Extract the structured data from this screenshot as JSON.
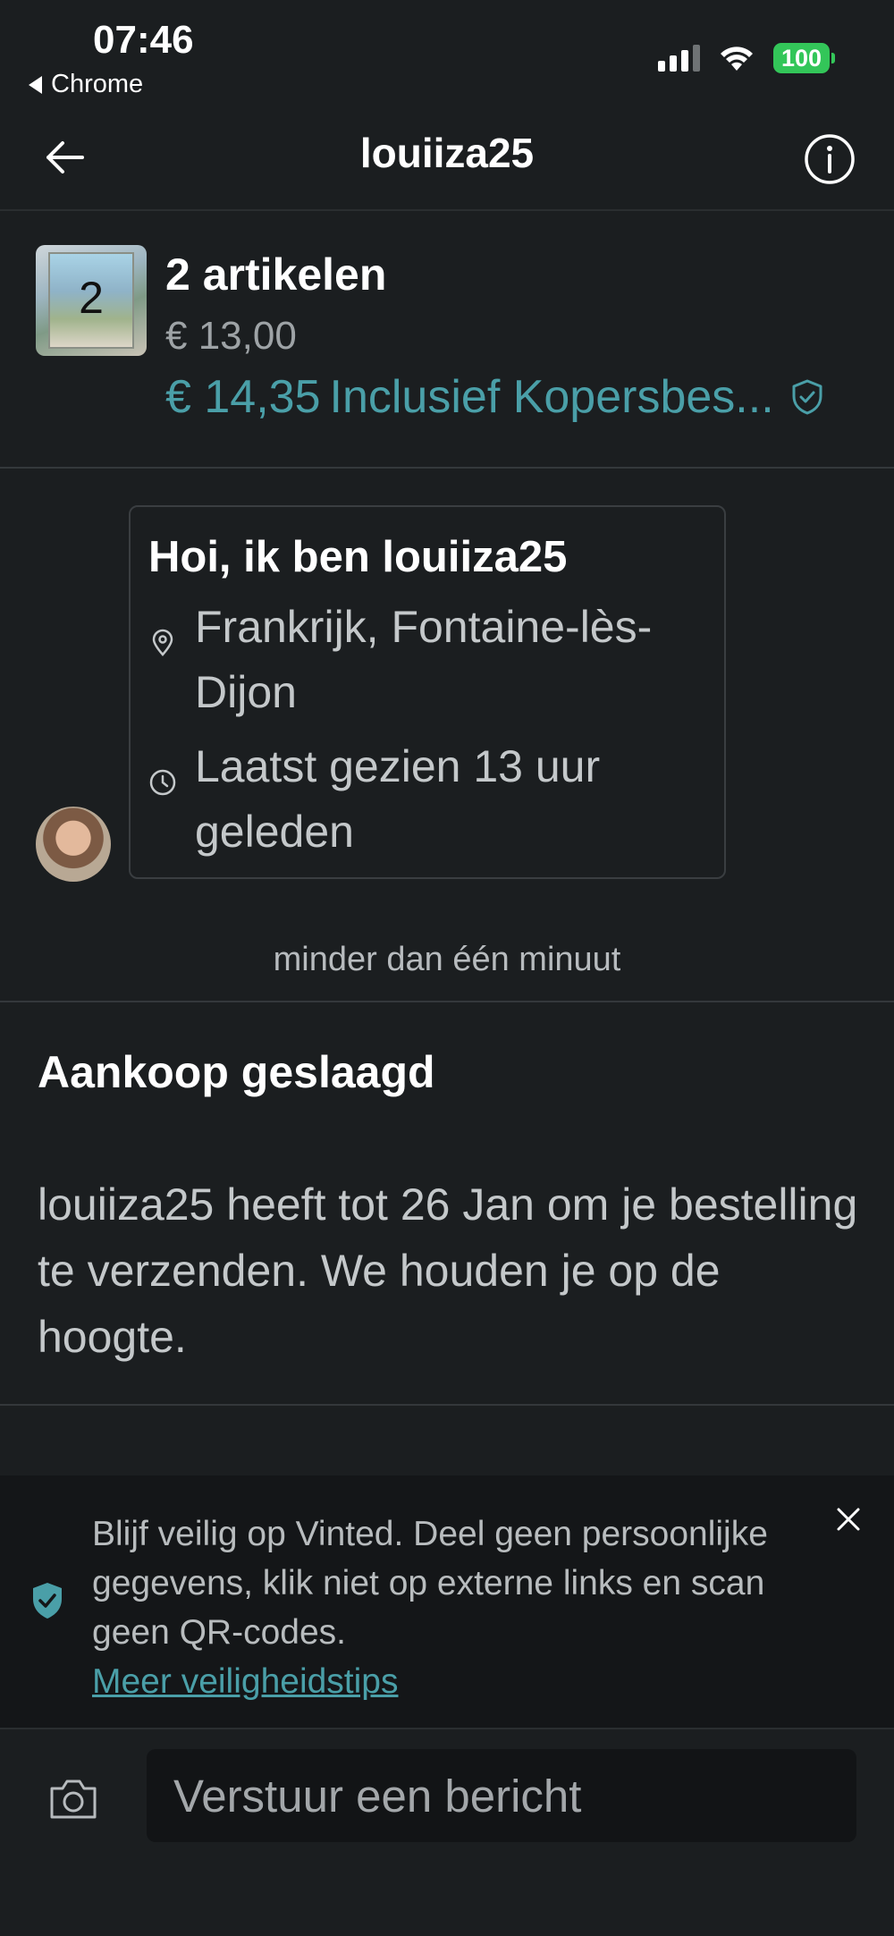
{
  "status_bar": {
    "time": "07:46",
    "back_app": "Chrome",
    "battery": "100"
  },
  "nav": {
    "title": "louiiza25"
  },
  "item": {
    "thumbnail_count": "2",
    "title": "2 artikelen",
    "price": "€ 13,00",
    "total_price": "€ 14,35",
    "total_note": "Inclusief Kopersbes..."
  },
  "profile": {
    "greeting": "Hoi, ik ben louiiza25",
    "location": "Frankrijk, Fontaine-lès-Dijon",
    "last_seen": "Laatst gezien 13 uur geleden"
  },
  "timestamp": "minder dan één minuut",
  "order_status": {
    "title": "Aankoop geslaagd",
    "body": "louiiza25 heeft tot 26 Jan om je bestelling te verzenden. We houden je op de hoogte."
  },
  "safety": {
    "text": "Blijf veilig op Vinted. Deel geen persoonlijke gegevens, klik niet op externe links en scan geen QR-codes.",
    "link": "Meer veiligheidstips"
  },
  "composer": {
    "placeholder": "Verstuur een bericht"
  },
  "colors": {
    "accent": "#4a9fa8",
    "background": "#1b1e20",
    "battery": "#33c659"
  }
}
